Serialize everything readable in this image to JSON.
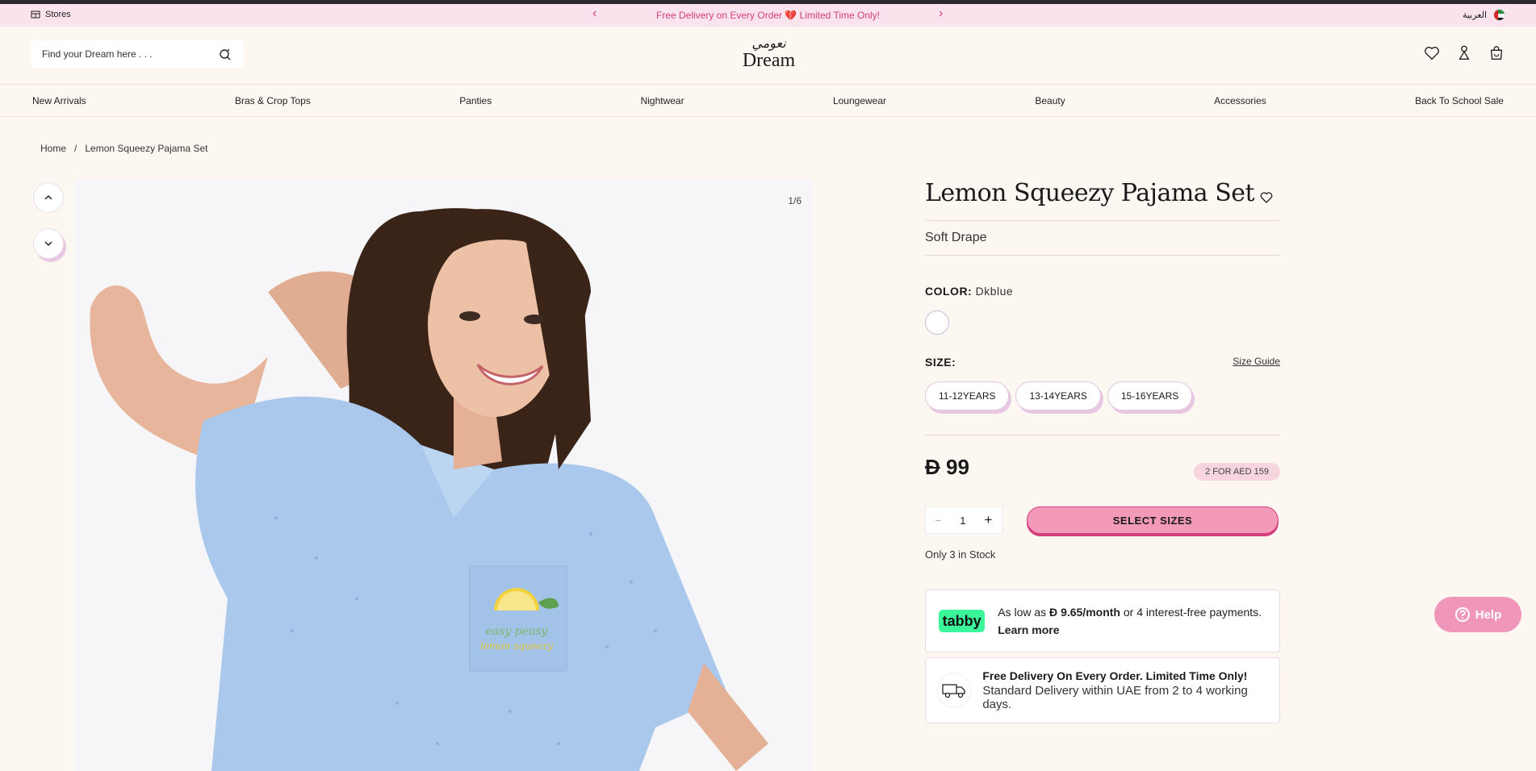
{
  "topbar": {
    "stores_label": "Stores",
    "promo_text": "Free Delivery on Every Order 💔 Limited Time Only!",
    "language_label": "العربية"
  },
  "header": {
    "search_placeholder": "Find your Dream here . . .",
    "logo_arabic": "نعومي",
    "logo_text": "Dream"
  },
  "nav": {
    "items": [
      "New Arrivals",
      "Bras & Crop Tops",
      "Panties",
      "Nightwear",
      "Loungewear",
      "Beauty",
      "Accessories",
      "Back To School Sale"
    ]
  },
  "breadcrumb": {
    "home": "Home",
    "separator": "/",
    "current": "Lemon Squeezy Pajama Set"
  },
  "gallery": {
    "counter": "1/6",
    "shirt_text_1": "easy peasy",
    "shirt_text_2": "lemon squeezy"
  },
  "product": {
    "title": "Lemon Squeezy Pajama Set",
    "subtitle": "Soft Drape",
    "color_label": "COLOR:",
    "color_value": "Dkblue",
    "size_label": "SIZE:",
    "size_guide": "Size Guide",
    "sizes": [
      "11-12YEARS",
      "13-14YEARS",
      "15-16YEARS"
    ],
    "currency_symbol": "Đ",
    "price": "99",
    "offer_badge": "2 FOR AED 159",
    "quantity": "1",
    "qty_minus": "−",
    "qty_plus": "+",
    "select_button": "SELECT SIZES",
    "stock_text": "Only 3 in Stock"
  },
  "tabby": {
    "logo": "tabby",
    "text_before": "As low as",
    "currency": "Đ",
    "amount": "9.65/month",
    "text_after": "or 4 interest-free payments.",
    "learn_more": "Learn more"
  },
  "delivery": {
    "title": "Free Delivery On Every Order. Limited Time Only!",
    "subtitle": "Standard Delivery within UAE from 2 to 4 working days."
  },
  "help": {
    "label": "Help"
  },
  "colors": {
    "promo_bar": "#fbe3ee",
    "accent_pink": "#d23d7c",
    "button_pink": "#f49ab9",
    "background": "#fdf7f2",
    "tabby_green": "#3bf59b"
  }
}
